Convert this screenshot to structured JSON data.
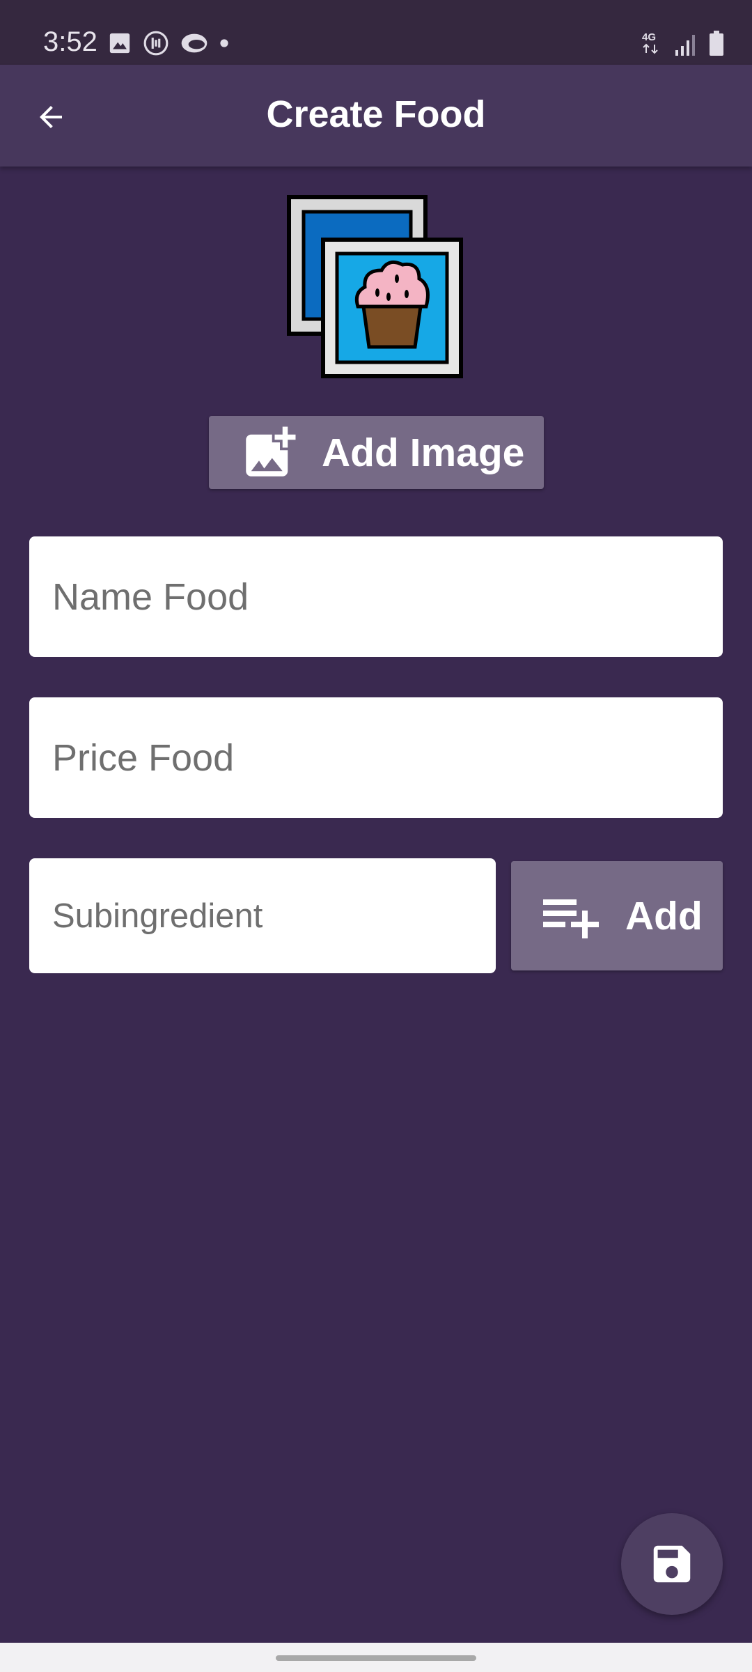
{
  "status_bar": {
    "time": "3:52",
    "left_icons": [
      "image-icon",
      "audio-app-icon",
      "cloud-app-icon",
      "dot-icon"
    ],
    "right_icons": [
      "4g-icon",
      "signal-icon",
      "battery-icon"
    ],
    "network_label": "4G"
  },
  "app_bar": {
    "title": "Create Food",
    "back_icon": "arrow-back-icon"
  },
  "image_section": {
    "placeholder_icon": "food-image-placeholder",
    "add_image_label": "Add Image",
    "add_image_icon": "add-photo-icon"
  },
  "form": {
    "name_placeholder": "Name Food",
    "name_value": "",
    "price_placeholder": "Price Food",
    "price_value": "",
    "subingredient_placeholder": "Subingredient",
    "subingredient_value": "",
    "add_label": "Add",
    "add_icon": "playlist-add-icon"
  },
  "fab": {
    "icon": "save-icon"
  },
  "colors": {
    "background": "#3a2950",
    "app_bar": "#47375c",
    "button": "#766a86",
    "fab": "#4e3f62"
  }
}
